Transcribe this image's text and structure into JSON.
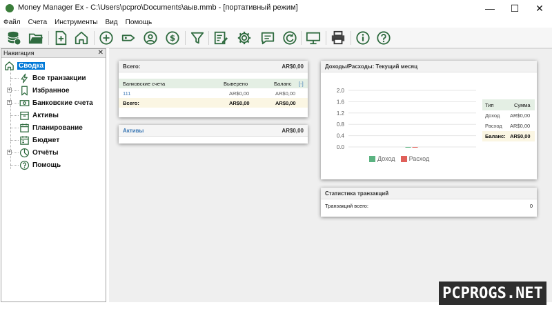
{
  "window": {
    "title": "Money Manager Ex - C:\\Users\\pcpro\\Documents\\аыв.mmb - [портативный режим]",
    "min_glyph": "—",
    "max_glyph": "☐",
    "close_glyph": "✕"
  },
  "menu": [
    "Файл",
    "Счета",
    "Инструменты",
    "Вид",
    "Помощь"
  ],
  "toolbar": {
    "buttons": [
      "database-icon",
      "open-folder-icon",
      "new-file-icon",
      "home-icon",
      "add-transaction-icon",
      "tag-icon",
      "payee-icon",
      "currency-icon",
      "filter-icon",
      "edit-report-icon",
      "settings-icon",
      "feedback-icon",
      "refresh-icon",
      "monitor-icon",
      "print-icon",
      "info-icon",
      "help-icon"
    ]
  },
  "nav": {
    "header": "Навигация",
    "close": "✕",
    "items": [
      {
        "label": "Сводка",
        "icon": "home-icon",
        "selected": true
      },
      {
        "label": "Все транзакции",
        "icon": "lightning-icon"
      },
      {
        "label": "Избранное",
        "icon": "bookmark-icon"
      },
      {
        "label": "Банковские счета",
        "icon": "bank-note-icon"
      },
      {
        "label": "Активы",
        "icon": "box-icon"
      },
      {
        "label": "Планирование",
        "icon": "calendar-icon"
      },
      {
        "label": "Бюджет",
        "icon": "budget-icon"
      },
      {
        "label": "Отчёты",
        "icon": "pie-chart-icon"
      },
      {
        "label": "Помощь",
        "icon": "question-icon"
      }
    ],
    "expander": "+"
  },
  "summary": {
    "total_label": "Всего:",
    "total_value": "AR$0,00",
    "accounts_header": [
      "Банковские счета",
      "Выверено",
      "Баланс",
      "[-]"
    ],
    "account_row": [
      "111",
      "AR$0,00",
      "AR$0,00"
    ],
    "accounts_total": [
      "Всего:",
      "AR$0,00",
      "AR$0,00"
    ],
    "assets_label": "Активы",
    "assets_value": "AR$0,00"
  },
  "income_expense": {
    "title": "Доходы/Расходы: Текущий месяц",
    "table_header": [
      "Тип",
      "Сумма"
    ],
    "rows": [
      [
        "Доход",
        "AR$0,00"
      ],
      [
        "Расход",
        "AR$0,00"
      ]
    ],
    "balance": [
      "Баланс:",
      "AR$0,00"
    ]
  },
  "stats": {
    "title": "Статистика транзакций",
    "total_label": "Транзакций всего:",
    "total_value": "0"
  },
  "chart_data": {
    "type": "bar",
    "categories": [
      ""
    ],
    "series": [
      {
        "name": "Доход",
        "values": [
          0
        ],
        "color": "#5bb381"
      },
      {
        "name": "Расход",
        "values": [
          0
        ],
        "color": "#e0605a"
      }
    ],
    "y_ticks": [
      "2.0",
      "1.6",
      "1.2",
      "0.8",
      "0.4",
      "0.0"
    ],
    "ylim": [
      0,
      2.0
    ],
    "grid": true,
    "legend_position": "bottom"
  },
  "watermark": "PCPROGS.NET",
  "colors": {
    "accent_green": "#2f6b3f",
    "selection_blue": "#0078d7",
    "link_blue": "#3c78b4"
  }
}
